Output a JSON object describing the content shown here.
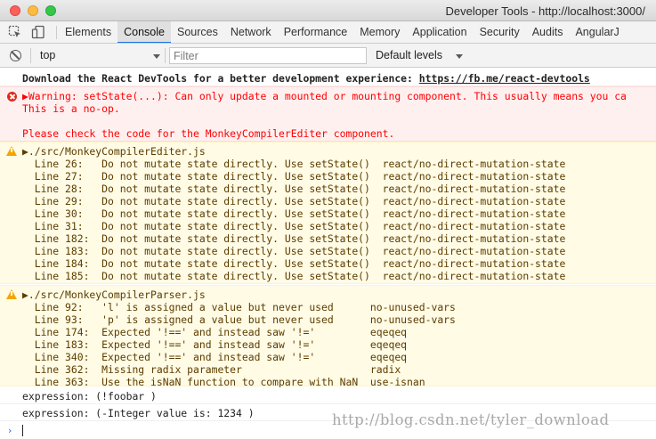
{
  "window": {
    "title": "Developer Tools - http://localhost:3000/"
  },
  "tabs": [
    {
      "label": "Elements"
    },
    {
      "label": "Console",
      "active": true
    },
    {
      "label": "Sources"
    },
    {
      "label": "Network"
    },
    {
      "label": "Performance"
    },
    {
      "label": "Memory"
    },
    {
      "label": "Application"
    },
    {
      "label": "Security"
    },
    {
      "label": "Audits"
    },
    {
      "label": "AngularJ"
    }
  ],
  "toolbar": {
    "context": "top",
    "filter_placeholder": "Filter",
    "levels": "Default levels"
  },
  "console": {
    "info": {
      "text": "Download the React DevTools for a better development experience: ",
      "link": "https://fb.me/react-devtools"
    },
    "error": {
      "lines": [
        "▶Warning: setState(...): Can only update a mounted or mounting component. This usually means you ca",
        "This is a no-op.",
        "",
        "Please check the code for the MonkeyCompilerEditer component."
      ]
    },
    "warning_editer": {
      "lines": [
        "▶./src/MonkeyCompilerEditer.js",
        "  Line 26:   Do not mutate state directly. Use setState()  react/no-direct-mutation-state",
        "  Line 27:   Do not mutate state directly. Use setState()  react/no-direct-mutation-state",
        "  Line 28:   Do not mutate state directly. Use setState()  react/no-direct-mutation-state",
        "  Line 29:   Do not mutate state directly. Use setState()  react/no-direct-mutation-state",
        "  Line 30:   Do not mutate state directly. Use setState()  react/no-direct-mutation-state",
        "  Line 31:   Do not mutate state directly. Use setState()  react/no-direct-mutation-state",
        "  Line 182:  Do not mutate state directly. Use setState()  react/no-direct-mutation-state",
        "  Line 183:  Do not mutate state directly. Use setState()  react/no-direct-mutation-state",
        "  Line 184:  Do not mutate state directly. Use setState()  react/no-direct-mutation-state",
        "  Line 185:  Do not mutate state directly. Use setState()  react/no-direct-mutation-state"
      ]
    },
    "warning_parser": {
      "lines": [
        "▶./src/MonkeyCompilerParser.js",
        "  Line 92:   'l' is assigned a value but never used      no-unused-vars",
        "  Line 93:   'p' is assigned a value but never used      no-unused-vars",
        "  Line 174:  Expected '!==' and instead saw '!='         eqeqeq",
        "  Line 183:  Expected '!==' and instead saw '!='         eqeqeq",
        "  Line 340:  Expected '!==' and instead saw '!='         eqeqeq",
        "  Line 362:  Missing radix parameter                     radix",
        "  Line 363:  Use the isNaN function to compare with NaN  use-isnan"
      ]
    },
    "expressions": [
      "expression: (!foobar )",
      "expression: (-Integer value is: 1234 )"
    ],
    "watermark": "http://blog.csdn.net/tyler_download",
    "prompt_symbol": "›"
  }
}
